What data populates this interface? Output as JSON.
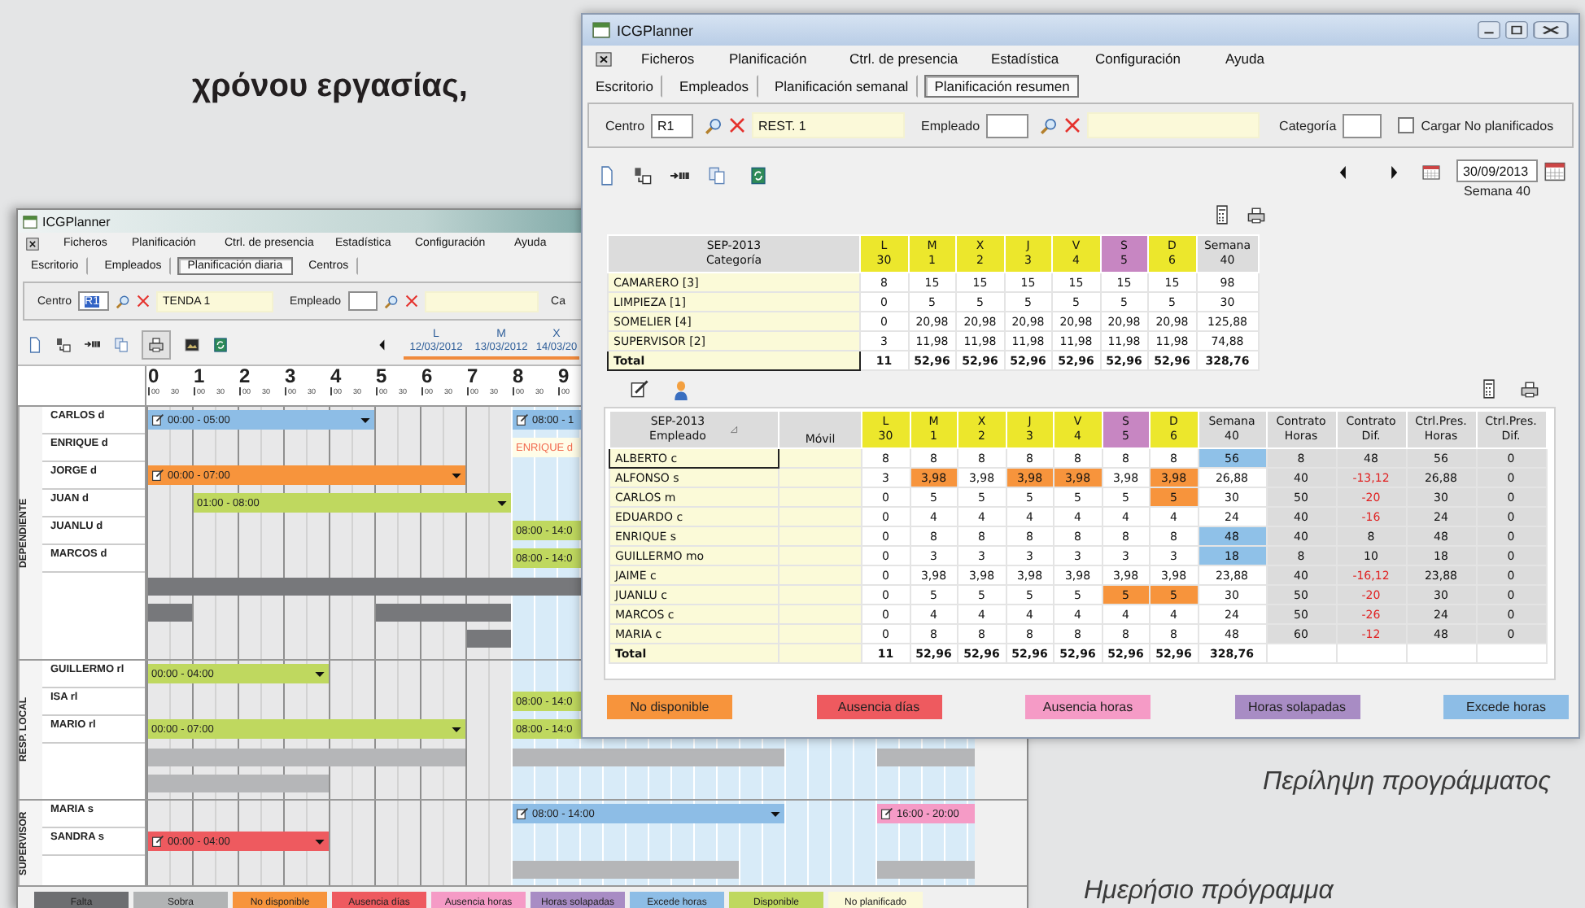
{
  "heading": "χρόνου εργασίας,",
  "daily_window": {
    "title": "ICGPlanner",
    "menu": [
      "Ficheros",
      "Planificación",
      "Ctrl. de presencia",
      "Estadística",
      "Configuración",
      "Ayuda"
    ],
    "tabs": [
      {
        "label": "Escritorio",
        "selected": false
      },
      {
        "label": "Empleados",
        "selected": false
      },
      {
        "label": "Planificación diaria",
        "selected": true
      },
      {
        "label": "Centros",
        "selected": false
      }
    ],
    "filters": {
      "centro_label": "Centro",
      "centro_value": "R1",
      "value_selected": true,
      "centro_name": "TENDA 1",
      "empleado_label": "Empleado",
      "categoria_label": "Ca"
    },
    "days": [
      {
        "weekday": "L",
        "date": "12/03/2012"
      },
      {
        "weekday": "M",
        "date": "13/03/2012"
      },
      {
        "weekday": "X",
        "date": "14/03/20"
      }
    ],
    "hours": [
      {
        "hour": "0",
        "marks": [
          "00",
          "30"
        ]
      },
      {
        "hour": "1",
        "marks": [
          "00",
          "30"
        ]
      },
      {
        "hour": "2",
        "marks": [
          "00",
          "30"
        ]
      },
      {
        "hour": "3",
        "marks": [
          "00",
          "30"
        ]
      },
      {
        "hour": "4",
        "marks": [
          "00",
          "30"
        ]
      },
      {
        "hour": "5",
        "marks": [
          "00",
          "30"
        ]
      },
      {
        "hour": "6",
        "marks": [
          "00",
          "30"
        ]
      },
      {
        "hour": "7",
        "marks": [
          "00",
          "30"
        ]
      },
      {
        "hour": "8",
        "marks": [
          "00",
          "30"
        ]
      },
      {
        "hour": "9",
        "marks": [
          "00"
        ]
      }
    ],
    "groups": [
      {
        "label": "DEPENDIENTE",
        "rows": [
          {
            "name": "CARLOS d",
            "bars": [
              {
                "text": "00:00 - 05:00",
                "kind": "bar",
                "color": "#8dbde6",
                "note": true,
                "caret": true
              },
              {
                "text": "08:00 - 1",
                "kind": "bar",
                "color": "#8dbde6",
                "note": true,
                "caret": false
              }
            ]
          },
          {
            "name": "ENRIQUE d",
            "bars": [
              {
                "text": "ENRIQUE d",
                "kind": "label",
                "color": "#f26b50",
                "note": false,
                "caret": false
              }
            ]
          },
          {
            "name": "JORGE d",
            "bars": [
              {
                "text": "00:00 - 07:00",
                "kind": "bar",
                "color": "#f7943c",
                "note": true,
                "caret": true
              }
            ]
          },
          {
            "name": "JUAN d",
            "bars": [
              {
                "text": "01:00 - 08:00",
                "kind": "bar",
                "color": "#bfd85f",
                "note": false,
                "caret": true
              }
            ]
          },
          {
            "name": "JUANLU d",
            "bars": [
              {
                "text": "08:00 - 14:0",
                "kind": "bar",
                "color": "#bfd85f",
                "note": false,
                "caret": false
              }
            ]
          },
          {
            "name": "MARCOS d",
            "bars": [
              {
                "text": "08:00 - 14:0",
                "kind": "bar",
                "color": "#bfd85f",
                "note": false,
                "caret": false
              }
            ]
          }
        ]
      },
      {
        "label": "RESP. LOCAL",
        "rows": [
          {
            "name": "GUILLERMO rl",
            "bars": [
              {
                "text": "00:00 - 04:00",
                "kind": "bar",
                "color": "#bfd85f",
                "note": false,
                "caret": true
              }
            ]
          },
          {
            "name": "ISA rl",
            "bars": [
              {
                "text": "08:00 - 14:0",
                "kind": "bar",
                "color": "#bfd85f",
                "note": false,
                "caret": false
              }
            ]
          },
          {
            "name": "MARIO rl",
            "bars": [
              {
                "text": "00:00 - 07:00",
                "kind": "bar",
                "color": "#bfd85f",
                "note": false,
                "caret": true
              },
              {
                "text": "08:00 - 14:0",
                "kind": "bar",
                "color": "#bfd85f",
                "note": false,
                "caret": false
              }
            ]
          }
        ]
      },
      {
        "label": "SUPERVISOR",
        "rows": [
          {
            "name": "MARIA s",
            "bars": [
              {
                "text": "08:00 - 14:00",
                "kind": "bar",
                "color": "#8dbde6",
                "note": true,
                "caret": true
              },
              {
                "text": "16:00 - 20:00",
                "kind": "bar",
                "color": "#f59bc6",
                "note": true,
                "caret": false
              }
            ]
          },
          {
            "name": "SANDRA s",
            "bars": [
              {
                "text": "00:00 - 04:00",
                "kind": "bar",
                "color": "#ee5a5f",
                "note": true,
                "caret": true
              }
            ]
          }
        ]
      }
    ],
    "legend": [
      {
        "label": "Falta",
        "color": "#6d6e71"
      },
      {
        "label": "Sobra",
        "color": "#b1b3b4"
      },
      {
        "label": "No disponible",
        "color": "#f7943c"
      },
      {
        "label": "Ausencia días",
        "color": "#ee5a5f"
      },
      {
        "label": "Ausencia horas",
        "color": "#f59bc6"
      },
      {
        "label": "Horas solapadas",
        "color": "#a88cc4"
      },
      {
        "label": "Excede horas",
        "color": "#8dbde6"
      },
      {
        "label": "Disponible",
        "color": "#bfd85f"
      },
      {
        "label": "No planificado",
        "color": "#fbf9d9"
      }
    ]
  },
  "summary_window": {
    "title": "ICGPlanner",
    "menu": [
      "Ficheros",
      "Planificación",
      "Ctrl. de presencia",
      "Estadística",
      "Configuración",
      "Ayuda"
    ],
    "tabs": [
      {
        "label": "Escritorio",
        "selected": false
      },
      {
        "label": "Empleados",
        "selected": false
      },
      {
        "label": "Planificación semanal",
        "selected": false
      },
      {
        "label": "Planificación resumen",
        "selected": true
      }
    ],
    "filters": {
      "centro_label": "Centro",
      "centro_value": "R1",
      "centro_name": "REST. 1",
      "empleado_label": "Empleado",
      "categoria_label": "Categoría",
      "checkbox": {
        "label": "Cargar No planificados",
        "checked": false
      }
    },
    "date": "30/09/2013",
    "week": "Semana 40",
    "category_table": {
      "header": [
        "SEP-2013",
        "Categoría"
      ],
      "days": [
        {
          "weekday": "L",
          "day": "30",
          "color": "#ece72c"
        },
        {
          "weekday": "M",
          "day": "1",
          "color": "#ece72c"
        },
        {
          "weekday": "X",
          "day": "2",
          "color": "#ece72c"
        },
        {
          "weekday": "J",
          "day": "3",
          "color": "#ece72c"
        },
        {
          "weekday": "V",
          "day": "4",
          "color": "#ece72c"
        },
        {
          "weekday": "S",
          "day": "5",
          "color": "#c786c2"
        },
        {
          "weekday": "D",
          "day": "6",
          "color": "#ece72c"
        }
      ],
      "week_header": [
        "Semana",
        "40"
      ],
      "rows": [
        {
          "name": "CAMARERO [3]",
          "kind": "item",
          "selected": false,
          "days": [
            "8",
            "15",
            "15",
            "15",
            "15",
            "15",
            "15"
          ],
          "week": "98"
        },
        {
          "name": "LIMPIEZA [1]",
          "kind": "item",
          "selected": false,
          "days": [
            "0",
            "5",
            "5",
            "5",
            "5",
            "5",
            "5"
          ],
          "week": "30"
        },
        {
          "name": "SOMELIER [4]",
          "kind": "item",
          "selected": false,
          "days": [
            "0",
            "20,98",
            "20,98",
            "20,98",
            "20,98",
            "20,98",
            "20,98"
          ],
          "week": "125,88"
        },
        {
          "name": "SUPERVISOR [2]",
          "kind": "item",
          "selected": false,
          "days": [
            "3",
            "11,98",
            "11,98",
            "11,98",
            "11,98",
            "11,98",
            "11,98"
          ],
          "week": "74,88"
        },
        {
          "name": "Total",
          "kind": "total",
          "selected": true,
          "days": [
            "11",
            "52,96",
            "52,96",
            "52,96",
            "52,96",
            "52,96",
            "52,96"
          ],
          "week": "328,76"
        }
      ]
    },
    "employee_table": {
      "header": [
        "SEP-2013",
        "Empleado"
      ],
      "mobile_header": "Móvil",
      "days": [
        {
          "weekday": "L",
          "day": "30",
          "color": "#ece72c"
        },
        {
          "weekday": "M",
          "day": "1",
          "color": "#ece72c"
        },
        {
          "weekday": "X",
          "day": "2",
          "color": "#ece72c"
        },
        {
          "weekday": "J",
          "day": "3",
          "color": "#ece72c"
        },
        {
          "weekday": "V",
          "day": "4",
          "color": "#ece72c"
        },
        {
          "weekday": "S",
          "day": "5",
          "color": "#c786c2"
        },
        {
          "weekday": "D",
          "day": "6",
          "color": "#ece72c"
        }
      ],
      "week_header": [
        "Semana",
        "40"
      ],
      "extra_headers": [
        [
          "Contrato",
          "Horas"
        ],
        [
          "Contrato",
          "Dif."
        ],
        [
          "Ctrl.Pres.",
          "Horas"
        ],
        [
          "Ctrl.Pres.",
          "Dif."
        ]
      ],
      "rows": [
        {
          "name": "ALBERTO c",
          "kind": "item",
          "selected": true,
          "days": [
            {
              "t": "8"
            },
            {
              "t": "8"
            },
            {
              "t": "8"
            },
            {
              "t": "8"
            },
            {
              "t": "8"
            },
            {
              "t": "8"
            },
            {
              "t": "8"
            }
          ],
          "week": {
            "t": "56",
            "color": "#8fc1e8"
          },
          "contract_hours": "8",
          "contract_diff": {
            "t": "48",
            "negative": false
          },
          "presence_hours": "56",
          "presence_diff": "0"
        },
        {
          "name": "ALFONSO s",
          "kind": "item",
          "selected": false,
          "days": [
            {
              "t": "3"
            },
            {
              "t": "3,98",
              "color": "#f7943c"
            },
            {
              "t": "3,98"
            },
            {
              "t": "3,98",
              "color": "#f7943c"
            },
            {
              "t": "3,98",
              "color": "#f7943c"
            },
            {
              "t": "3,98"
            },
            {
              "t": "3,98",
              "color": "#f7943c"
            }
          ],
          "week": {
            "t": "26,88"
          },
          "contract_hours": "40",
          "contract_diff": {
            "t": "-13,12",
            "negative": true
          },
          "presence_hours": "26,88",
          "presence_diff": "0"
        },
        {
          "name": "CARLOS m",
          "kind": "item",
          "selected": false,
          "days": [
            {
              "t": "0"
            },
            {
              "t": "5"
            },
            {
              "t": "5"
            },
            {
              "t": "5"
            },
            {
              "t": "5"
            },
            {
              "t": "5"
            },
            {
              "t": "5",
              "color": "#f7943c"
            }
          ],
          "week": {
            "t": "30"
          },
          "contract_hours": "50",
          "contract_diff": {
            "t": "-20",
            "negative": true
          },
          "presence_hours": "30",
          "presence_diff": "0"
        },
        {
          "name": "EDUARDO c",
          "kind": "item",
          "selected": false,
          "days": [
            {
              "t": "0"
            },
            {
              "t": "4"
            },
            {
              "t": "4"
            },
            {
              "t": "4"
            },
            {
              "t": "4"
            },
            {
              "t": "4"
            },
            {
              "t": "4"
            }
          ],
          "week": {
            "t": "24"
          },
          "contract_hours": "40",
          "contract_diff": {
            "t": "-16",
            "negative": true
          },
          "presence_hours": "24",
          "presence_diff": "0"
        },
        {
          "name": "ENRIQUE s",
          "kind": "item",
          "selected": false,
          "days": [
            {
              "t": "0"
            },
            {
              "t": "8"
            },
            {
              "t": "8"
            },
            {
              "t": "8"
            },
            {
              "t": "8"
            },
            {
              "t": "8"
            },
            {
              "t": "8"
            }
          ],
          "week": {
            "t": "48",
            "color": "#8fc1e8"
          },
          "contract_hours": "40",
          "contract_diff": {
            "t": "8",
            "negative": false
          },
          "presence_hours": "48",
          "presence_diff": "0"
        },
        {
          "name": "GUILLERMO mo",
          "kind": "item",
          "selected": false,
          "days": [
            {
              "t": "0"
            },
            {
              "t": "3"
            },
            {
              "t": "3"
            },
            {
              "t": "3"
            },
            {
              "t": "3"
            },
            {
              "t": "3"
            },
            {
              "t": "3"
            }
          ],
          "week": {
            "t": "18",
            "color": "#8fc1e8"
          },
          "contract_hours": "8",
          "contract_diff": {
            "t": "10",
            "negative": false
          },
          "presence_hours": "18",
          "presence_diff": "0"
        },
        {
          "name": "JAIME c",
          "kind": "item",
          "selected": false,
          "days": [
            {
              "t": "0"
            },
            {
              "t": "3,98"
            },
            {
              "t": "3,98"
            },
            {
              "t": "3,98"
            },
            {
              "t": "3,98"
            },
            {
              "t": "3,98"
            },
            {
              "t": "3,98"
            }
          ],
          "week": {
            "t": "23,88"
          },
          "contract_hours": "40",
          "contract_diff": {
            "t": "-16,12",
            "negative": true
          },
          "presence_hours": "23,88",
          "presence_diff": "0"
        },
        {
          "name": "JUANLU c",
          "kind": "item",
          "selected": false,
          "days": [
            {
              "t": "0"
            },
            {
              "t": "5"
            },
            {
              "t": "5"
            },
            {
              "t": "5"
            },
            {
              "t": "5"
            },
            {
              "t": "5",
              "color": "#f7943c"
            },
            {
              "t": "5",
              "color": "#f7943c"
            }
          ],
          "week": {
            "t": "30"
          },
          "contract_hours": "50",
          "contract_diff": {
            "t": "-20",
            "negative": true
          },
          "presence_hours": "30",
          "presence_diff": "0"
        },
        {
          "name": "MARCOS c",
          "kind": "item",
          "selected": false,
          "days": [
            {
              "t": "0"
            },
            {
              "t": "4"
            },
            {
              "t": "4"
            },
            {
              "t": "4"
            },
            {
              "t": "4"
            },
            {
              "t": "4"
            },
            {
              "t": "4"
            }
          ],
          "week": {
            "t": "24"
          },
          "contract_hours": "50",
          "contract_diff": {
            "t": "-26",
            "negative": true
          },
          "presence_hours": "24",
          "presence_diff": "0"
        },
        {
          "name": "MARIA c",
          "kind": "item",
          "selected": false,
          "days": [
            {
              "t": "0"
            },
            {
              "t": "8"
            },
            {
              "t": "8"
            },
            {
              "t": "8"
            },
            {
              "t": "8"
            },
            {
              "t": "8"
            },
            {
              "t": "8"
            }
          ],
          "week": {
            "t": "48"
          },
          "contract_hours": "60",
          "contract_diff": {
            "t": "-12",
            "negative": true
          },
          "presence_hours": "48",
          "presence_diff": "0"
        },
        {
          "name": "Total",
          "kind": "total",
          "selected": false,
          "days": [
            {
              "t": "11"
            },
            {
              "t": "52,96"
            },
            {
              "t": "52,96"
            },
            {
              "t": "52,96"
            },
            {
              "t": "52,96"
            },
            {
              "t": "52,96"
            },
            {
              "t": "52,96"
            }
          ],
          "week": {
            "t": "328,76"
          }
        }
      ]
    },
    "legend": [
      {
        "label": "No disponible",
        "color": "#f7943c"
      },
      {
        "label": "Ausencia días",
        "color": "#ee5a5f"
      },
      {
        "label": "Ausencia horas",
        "color": "#f59bc6"
      },
      {
        "label": "Horas solapadas",
        "color": "#a88cc4"
      },
      {
        "label": "Excede horas",
        "color": "#8dbde6"
      }
    ]
  },
  "captions": [
    "Περίληψη προγράμματος",
    "Ημερήσιο πρόγραμμα"
  ]
}
